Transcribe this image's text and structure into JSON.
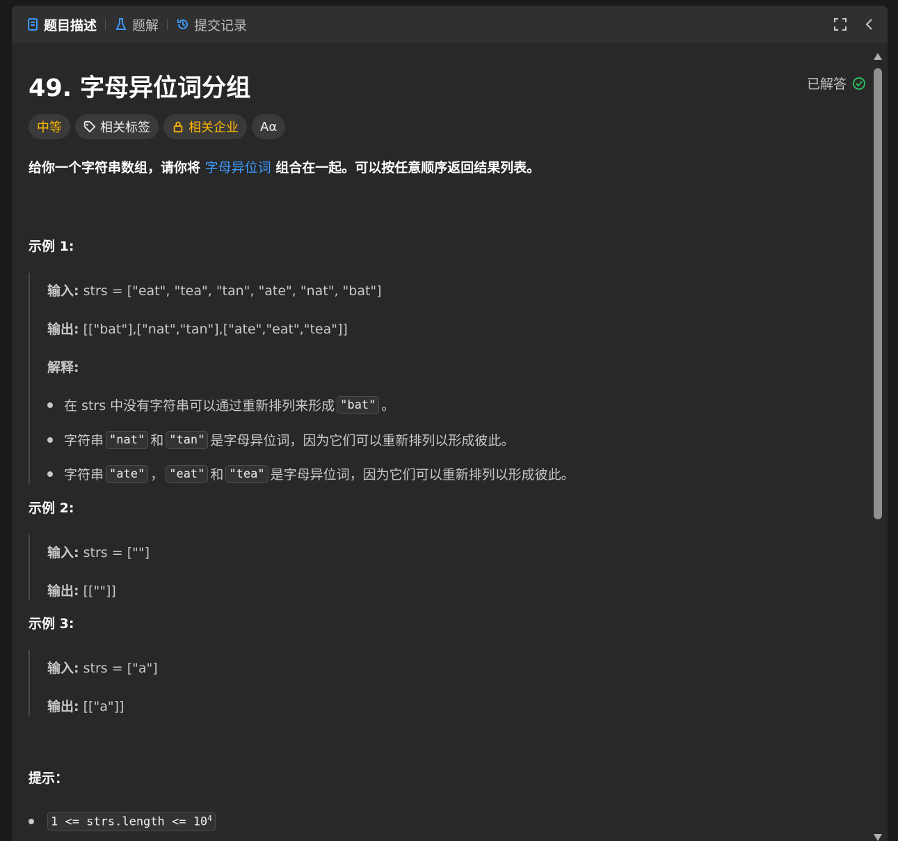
{
  "tabs": [
    {
      "label": "题目描述",
      "icon": "document-icon",
      "active": true
    },
    {
      "label": "题解",
      "icon": "flask-icon",
      "active": false
    },
    {
      "label": "提交记录",
      "icon": "history-icon",
      "active": false
    }
  ],
  "problem": {
    "title": "49. 字母异位词分组",
    "status": "已解答",
    "tags": {
      "difficulty": "中等",
      "related_tags": "相关标签",
      "related_companies": "相关企业",
      "translate_icon_text": "Aα"
    },
    "description": {
      "before": "给你一个字符串数组，请你将 ",
      "link": "字母异位词",
      "after": " 组合在一起。可以按任意顺序返回结果列表。"
    }
  },
  "examples": [
    {
      "title": "示例 1:",
      "input_label": "输入:",
      "input": " strs = [\"eat\", \"tea\", \"tan\", \"ate\", \"nat\", \"bat\"]",
      "output_label": "输出:",
      "output": " [[\"bat\"],[\"nat\",\"tan\"],[\"ate\",\"eat\",\"tea\"]]",
      "explain_label": "解释:",
      "bullets": [
        {
          "t1": "在 strs 中没有字符串可以通过重新排列来形成 ",
          "c1": "\"bat\"",
          "t2": "。"
        },
        {
          "t1": "字符串 ",
          "c1": "\"nat\"",
          "t2": " 和 ",
          "c2": "\"tan\"",
          "t3": " 是字母异位词，因为它们可以重新排列以形成彼此。"
        },
        {
          "t1": "字符串 ",
          "c1": "\"ate\"",
          "t2": " ，",
          "c2": "\"eat\"",
          "t3": " 和 ",
          "c3": "\"tea\"",
          "t4": " 是字母异位词，因为它们可以重新排列以形成彼此。"
        }
      ]
    },
    {
      "title": "示例 2:",
      "input_label": "输入:",
      "input": " strs = [\"\"]",
      "output_label": "输出:",
      "output": " [[\"\"]]"
    },
    {
      "title": "示例 3:",
      "input_label": "输入:",
      "input": " strs = [\"a\"]",
      "output_label": "输出:",
      "output": " [[\"a\"]]"
    }
  ],
  "hints": {
    "title": "提示：",
    "items": [
      {
        "code": "1 <= strs.length <= 10",
        "sup": "4"
      }
    ]
  },
  "colors": {
    "accent": "#3c9aff",
    "difficulty": "#ffb800",
    "solved": "#2cbb5d"
  }
}
